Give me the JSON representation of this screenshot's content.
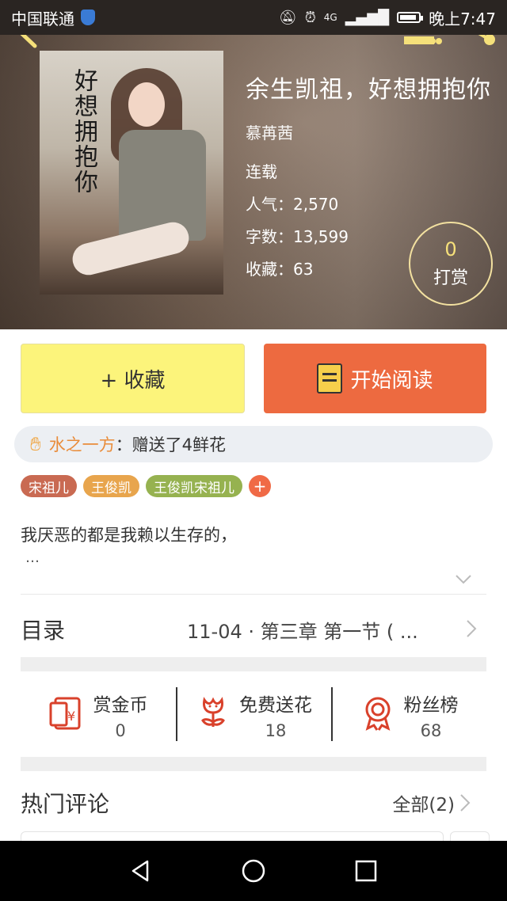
{
  "status_bar": {
    "carrier": "中国联通",
    "network": "4G",
    "time": "晚上7:47"
  },
  "book": {
    "cover_title": "好想拥抱你",
    "title": "余生凯祖，好想拥抱你",
    "author": "慕苒茜",
    "status": "连载",
    "popularity": "人气：2,570",
    "word_count": "字数：13,599",
    "favorites": "收藏：63"
  },
  "tip": {
    "count": "0",
    "label": "打赏"
  },
  "actions": {
    "favorite_label": "+ 收藏",
    "read_label": "开始阅读"
  },
  "ticker": {
    "user": "水之一方",
    "message": "：赠送了4鲜花"
  },
  "tags": [
    {
      "label": "宋祖儿"
    },
    {
      "label": "王俊凯"
    },
    {
      "label": "王俊凯宋祖儿"
    }
  ],
  "tag_add": "+",
  "description": {
    "text": "我厌恶的都是我赖以生存的，",
    "ellipsis": "…"
  },
  "catalog": {
    "label": "目录",
    "latest": "11-04 · 第三章  第一节   ( ..."
  },
  "stats": [
    {
      "name": "赏金币",
      "value": "0"
    },
    {
      "name": "免费送花",
      "value": "18"
    },
    {
      "name": "粉丝榜",
      "value": "68"
    }
  ],
  "comments": {
    "title": "热门评论",
    "all_label": "全部(2)"
  },
  "colors": {
    "accent_orange": "#ed6a40",
    "favorite_yellow": "#fcf47b",
    "icon_red": "#d9412b"
  }
}
